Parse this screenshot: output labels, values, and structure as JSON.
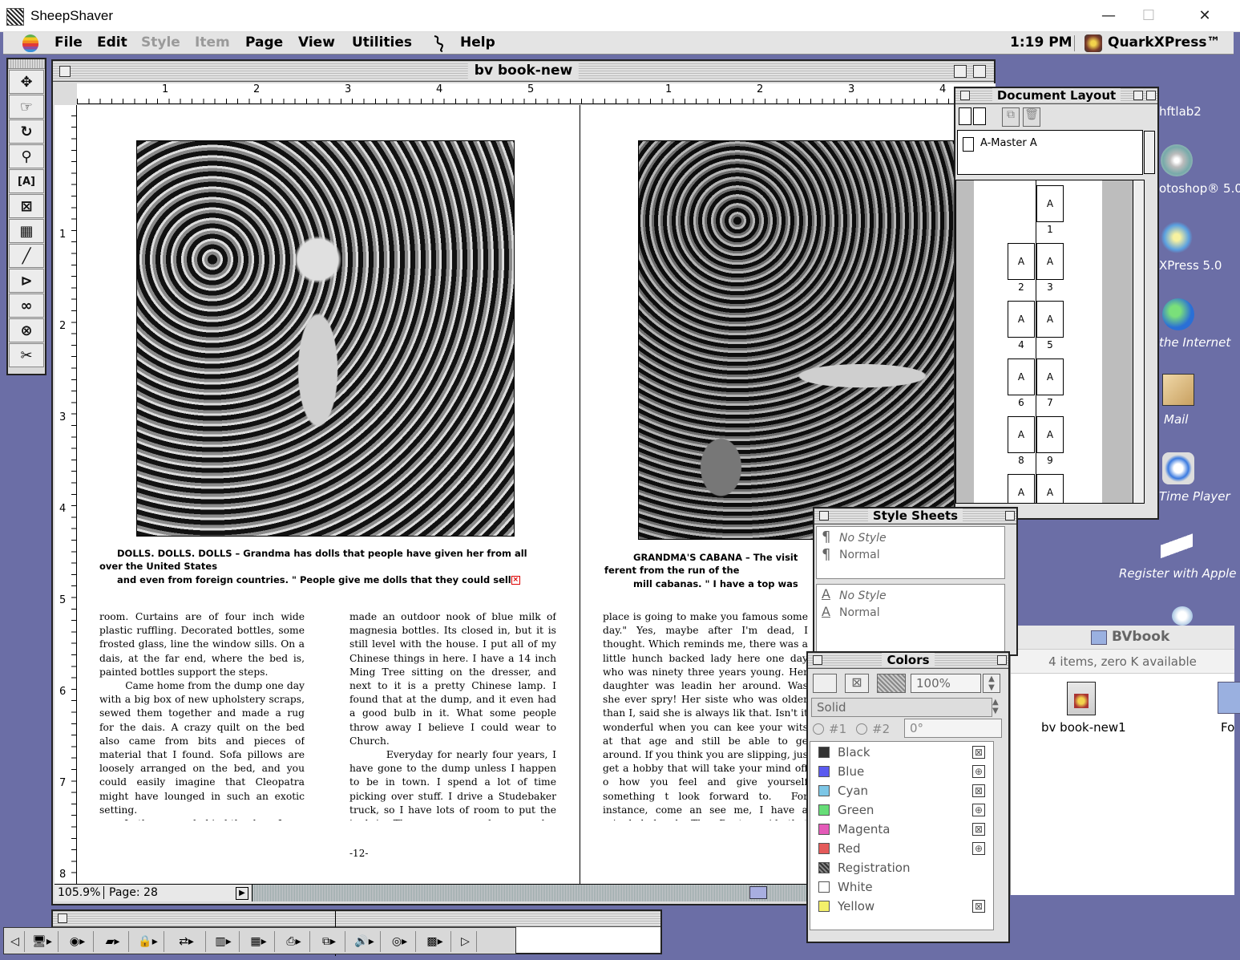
{
  "host": {
    "title": "SheepShaver",
    "minimize": "—",
    "maximize": "☐",
    "close": "✕"
  },
  "menubar": {
    "items": [
      "File",
      "Edit",
      "Style",
      "Item",
      "Page",
      "View",
      "Utilities",
      "Help"
    ],
    "disabled": [
      "Style",
      "Item"
    ],
    "clock": "1:19 PM",
    "app_name": "QuarkXPress™"
  },
  "document": {
    "title": "bv book-new",
    "ruler_h": [
      "1",
      "2",
      "3",
      "4",
      "5",
      "1",
      "2",
      "3",
      "4"
    ],
    "ruler_v": [
      "1",
      "2",
      "3",
      "4",
      "5",
      "6",
      "7",
      "8"
    ],
    "left_caption": {
      "line1": "DOLLS. DOLLS. DOLLS – Grandma has dolls that people have given her from all",
      "line2": "over the United States",
      "line3": "and even from foreign countries.    \" People give me dolls that they could sell"
    },
    "right_caption": {
      "line1": "GRANDMA'S CABANA – The visit",
      "line2": "ferent from the run of the",
      "line3": "mill cabanas.   \" I have a top was"
    },
    "col1": "room. Curtains are of four inch wide plastic ruffling. Decorated bottles, some frosted glass, line the window sills. On a dais, at the far end, where the bed is, painted bottles support the steps.\n        Came home from the dump one day with a big box of new upholstery scraps, sewed them together and made a rug for the dais. A crazy quilt on the bed also came from bits and pieces of material that I found. Sofa pillows are loosely arranged on the bed, and you could easily imagine that Cleopatra might have lounged in such an exotic setting.\n        In the corner behind the door, I",
    "col2": "made an outdoor nook of blue milk of magnesia bottles. Its closed in, but it is still level with the house. I put all of my Chinese things in here. I have a 14 inch Ming Tree sitting on the dresser, and next to it is a pretty Chinese lamp. I found that at the dump, and it even had a good bulb in it. What some people throw away I believe I could wear to Church.\n        Everyday for nearly four years, I have gone to the dump unless I happen to be in town. I spend a lot of time picking over stuff. I drive a Studebaker truck, so I have lots of room to put the junk in. There was a man here one day he said, \"Lady, this",
    "col3": "place is going to make you famous some day.\" Yes, maybe after I'm dead, I thought. Which reminds me, there was a little hunch backed lady here one day who was ninety three years young. Her daughter was leadin her around. Was she ever spry! Her siste who was older than I, said she is always lik that. Isn't it wonderful when you can kee your wits at that age and still be able to ge around. If you think you are slipping, jus get a hobby that will take your mind off o how you feel and give yourself something t look forward to.  For instance, come an see me, I have a crippled hand. The Docto said that arthritis had set in, and I woul",
    "folio": "-12-",
    "zoom": "105.9%",
    "page": "Page: 28"
  },
  "doc_layout": {
    "title": "Document Layout",
    "master": "A-Master A",
    "pages": [
      {
        "label": "A",
        "num": "1"
      },
      {
        "label": "A",
        "num": "2"
      },
      {
        "label": "A",
        "num": "3"
      },
      {
        "label": "A",
        "num": "4"
      },
      {
        "label": "A",
        "num": "5"
      },
      {
        "label": "A",
        "num": "6"
      },
      {
        "label": "A",
        "num": "7"
      },
      {
        "label": "A",
        "num": "8"
      },
      {
        "label": "A",
        "num": "9"
      },
      {
        "label": "A",
        "num": ""
      },
      {
        "label": "A",
        "num": ""
      }
    ]
  },
  "style_sheets": {
    "title": "Style Sheets",
    "para": [
      "No Style",
      "Normal"
    ],
    "char": [
      "No Style",
      "Normal"
    ]
  },
  "colors": {
    "title": "Colors",
    "shade": "100%",
    "blend": "Solid",
    "radio1": "#1",
    "radio2": "#2",
    "angle": "0°",
    "list": [
      {
        "name": "Black",
        "hex": "#333333"
      },
      {
        "name": "Blue",
        "hex": "#5b5bf0"
      },
      {
        "name": "Cyan",
        "hex": "#7cc6e6"
      },
      {
        "name": "Green",
        "hex": "#66dd77"
      },
      {
        "name": "Magenta",
        "hex": "#e45ab8"
      },
      {
        "name": "Red",
        "hex": "#e45a5a"
      },
      {
        "name": "Registration",
        "hex": "#555555"
      },
      {
        "name": "White",
        "hex": "#ffffff"
      },
      {
        "name": "Yellow",
        "hex": "#f4f06a"
      }
    ]
  },
  "desktop": {
    "labels": [
      "hftlab2",
      "otoshop® 5.0",
      "XPress 5.0",
      "the Internet",
      "Mail",
      "Time Player",
      "Register with Apple"
    ]
  },
  "finder": {
    "title": "BVbook",
    "info": "4 items, zero K available",
    "file1": "bv book-new1",
    "file2": "Fo"
  }
}
